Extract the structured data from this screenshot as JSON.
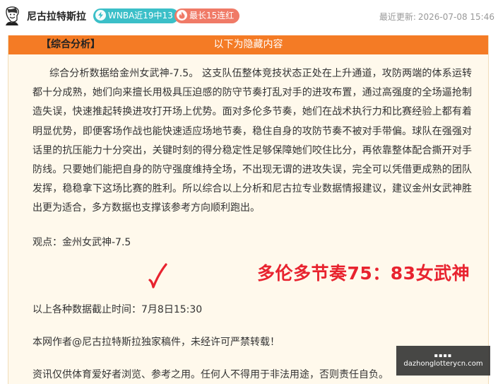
{
  "header": {
    "author": "尼古拉特斯拉",
    "badge_record": "WNBA近19中13",
    "badge_streak": "最长15连红",
    "updated_label": "最近更新:",
    "updated_time": "2026-07-08 15:46"
  },
  "panel": {
    "banner": "以下为隐藏内容",
    "heading": "【综合分析】",
    "paragraph": "综合分析数据给金州女武神-7.5。 这支队伍整体竞技状态正处在上升通道，攻防两端的体系运转都十分成熟，她们向来擅长用极具压迫感的防守节奏打乱对手的进攻布置，通过高强度的全场逼抢制造失误，快速推起转换进攻打开场上优势。面对多伦多节奏，她们在战术执行力和比赛经验上都有着明显优势，即便客场作战也能快速适应场地节奏，稳住自身的攻防节奏不被对手带偏。球队在强强对话里的抗压能力十分突出，关键时刻的得分稳定性足够保障她们咬住比分，再依靠整体配合撕开对手防线。只要她们能把自身的防守强度维持全场，不出现无谓的进攻失误，完全可以凭借更成熟的团队发挥，稳稳拿下这场比赛的胜利。所以综合以上分析和尼古拉专业数据情报建议，建议金州女武神胜出更为适合，多方数据也支撑该参考方向顺利跑出。",
    "view": "观点：金州女武神-7.5",
    "cutoff": "以上各种数据截止时间：7月8日15:30",
    "copyright": "本网作者@尼古拉特斯拉独家稿件，未经许可严禁转载！",
    "disclaimer": "资讯仅供体育爱好者浏览、参考之用。任何人不得用于非法用途，否则责任自负。",
    "prediction": "多伦多节奏75：83女武神"
  },
  "watermark": {
    "top": "▪▪▪▪",
    "site": "dazhonglotterycn.com"
  },
  "colors": {
    "banner": "#f47b25",
    "badge_record": "#3bbfc8",
    "badge_streak": "#f07a67",
    "prediction": "#e8232f",
    "panel_bg": "#fff9ec"
  },
  "icons": {
    "avatar": "portrait-sketch-icon",
    "badge_record": "lightning-icon",
    "badge_streak": "flame-icon",
    "check": "red-checkmark-icon"
  }
}
